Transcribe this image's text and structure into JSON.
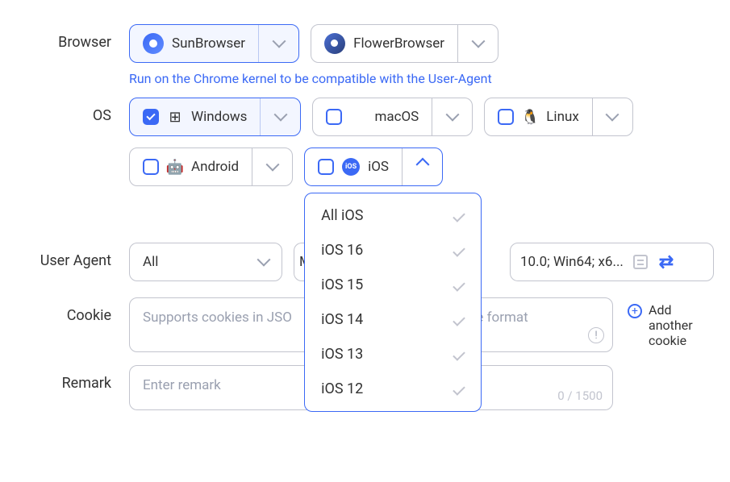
{
  "labels": {
    "browser": "Browser",
    "os": "OS",
    "userAgent": "User Agent",
    "cookie": "Cookie",
    "remark": "Remark"
  },
  "browsers": {
    "sun": "SunBrowser",
    "flower": "FlowerBrowser",
    "hint": "Run on the Chrome kernel to be compatible with the User-Agent"
  },
  "os": {
    "windows": "Windows",
    "macos": "macOS",
    "linux": "Linux",
    "android": "Android",
    "ios": "iOS"
  },
  "iosOptions": [
    "All iOS",
    "iOS 16",
    "iOS 15",
    "iOS 14",
    "iOS 13",
    "iOS 12"
  ],
  "userAgent": {
    "all": "All",
    "leftPartial": "M",
    "text": "10.0; Win64; x6..."
  },
  "cookie": {
    "placeholder": "Supports cookies in JSO",
    "placeholderTail": "e format",
    "addLabel": "Add another cookie"
  },
  "remark": {
    "placeholder": "Enter remark",
    "counter": "0 / 1500"
  },
  "icons": {
    "iosBadge": "iOS"
  }
}
